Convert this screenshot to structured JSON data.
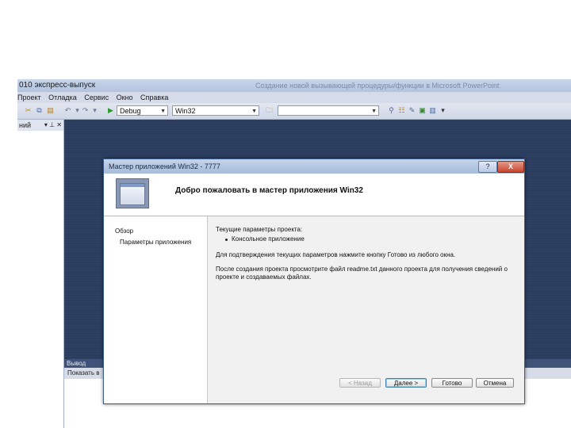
{
  "ide": {
    "title": "010 экспресс-выпуск",
    "window_title_faint": "Создание новой вызывающей процедуры/функции в Microsoft PowerPoint",
    "menu": [
      "Проект",
      "Отладка",
      "Сервис",
      "Окно",
      "Справка"
    ],
    "toolbar": {
      "config_value": "Debug",
      "platform_value": "Win32",
      "find_value": ""
    },
    "left_panel": {
      "label": "ний",
      "controls": "▾ ⊥ ✕"
    },
    "output": {
      "title": "Вывод",
      "show_label": "Показать в"
    }
  },
  "dialog": {
    "title": "Мастер приложений Win32 - 7777",
    "help_label": "?",
    "close_label": "X",
    "header_title": "Добро пожаловать в мастер приложения Win32",
    "nav": [
      "Обзор",
      "Параметры приложения"
    ],
    "content": {
      "current_params": "Текущие параметры проекта:",
      "bullet": "Консольное приложение",
      "line1": "Для подтверждения текущих параметров нажмите кнопку Готово из любого окна.",
      "line2a": "После создания проекта просмотрите файл readme.txt данного проекта для получения сведений о",
      "line2b": "проекте и создаваемых файлах."
    },
    "buttons": {
      "back": "< Назад",
      "next": "Далее >",
      "finish": "Готово",
      "cancel": "Отмена"
    }
  },
  "colors": {
    "workspace": "#2b3d5f",
    "dialog_border": "#3e5f8c",
    "close_button": "#c9442c"
  }
}
